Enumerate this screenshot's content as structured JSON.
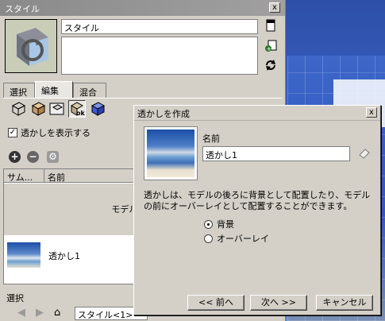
{
  "panel": {
    "title": "スタイル",
    "close_label": "x",
    "style_name": "スタイル",
    "tabs": [
      "選択",
      "編集",
      "混合"
    ],
    "show_watermark_label": "透かしを表示する",
    "show_watermark_checked": "✓",
    "list_columns": [
      "サム...",
      "名前"
    ],
    "model_space_label": "モデル スペース",
    "watermark_item": "透かし1",
    "bottom_label": "選択",
    "combo_value": "スタイル<1>"
  },
  "dialog": {
    "title": "透かしを作成",
    "close_label": "x",
    "name_label": "名前",
    "name_value": "透かし1",
    "description": "透かしは、モデルの後ろに背景として配置したり、モデルの前にオーバーレイとして配置することができます。",
    "option_background": "背景",
    "option_overlay": "オーバーレイ",
    "selected": "background",
    "back_button": "<< 前へ",
    "next_button": "次へ >>",
    "cancel_button": "キャンセル"
  },
  "icons": {
    "side_buttons": [
      "template-icon",
      "add-style-icon",
      "refresh-icon"
    ],
    "tools": [
      "edge-settings-icon",
      "face-settings-icon",
      "background-settings-icon",
      "watermark-settings-icon",
      "modeling-settings-icon"
    ],
    "actions": [
      "add-icon",
      "remove-icon",
      "settings-icon"
    ],
    "nav": [
      "back-icon",
      "forward-icon",
      "home-icon"
    ]
  },
  "colors": {
    "desktop": "#3b63c6",
    "panel_bg": "#d4d0c8",
    "title_bar": "#9a9a9a"
  }
}
